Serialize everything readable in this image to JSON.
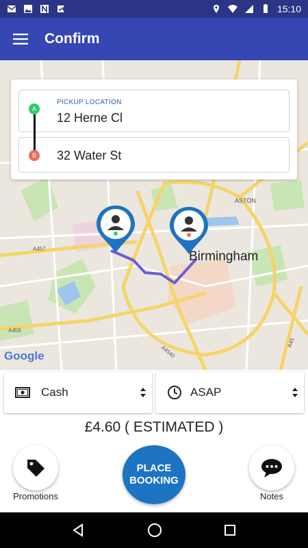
{
  "status_bar": {
    "time": "15:10"
  },
  "app_bar": {
    "title": "Confirm"
  },
  "map": {
    "city_label": "Birmingham",
    "area_label": "ASTON",
    "road_labels": [
      "A457",
      "A456",
      "A4540",
      "A45"
    ],
    "logo_text": "Google"
  },
  "locations": {
    "pickup_label": "PICKUP LOCATION",
    "pickup_value": "12 Herne Cl",
    "pickup_marker": "A",
    "dropoff_value": "32 Water St",
    "dropoff_marker": "B"
  },
  "payment": {
    "value": "Cash",
    "icon": "cash-icon"
  },
  "timing": {
    "value": "ASAP",
    "icon": "clock-icon"
  },
  "price": {
    "text": "£4.60 ( ESTIMATED )"
  },
  "actions": {
    "promotions_label": "Promotions",
    "place_booking_line1": "PLACE",
    "place_booking_line2": "BOOKING",
    "notes_label": "Notes"
  },
  "colors": {
    "status_bar": "#2a3585",
    "app_bar": "#3646b2",
    "primary_button": "#1c74c3",
    "route": "#6a5fd1",
    "marker_a": "#2ecc71",
    "marker_b": "#f06a5a"
  }
}
